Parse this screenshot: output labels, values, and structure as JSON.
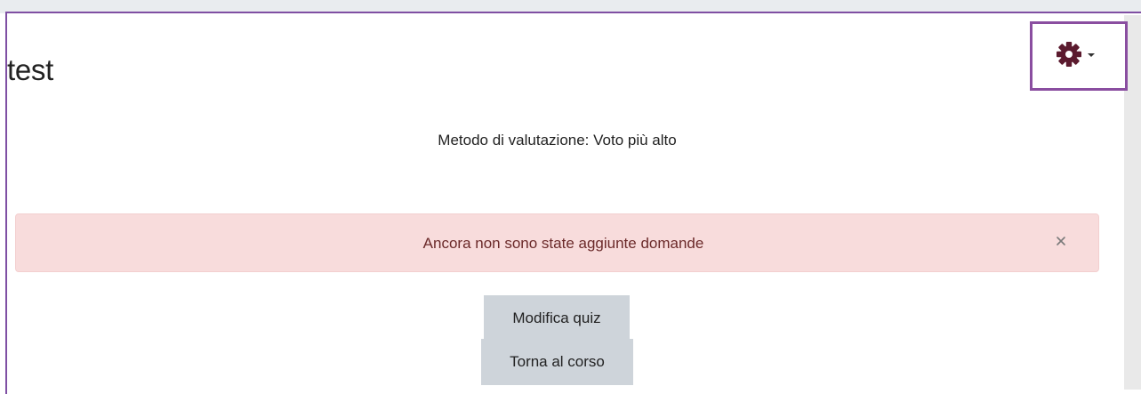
{
  "page": {
    "title": "test"
  },
  "settings_menu": {
    "icon": "gear-icon",
    "caret_icon": "caret-down-icon",
    "highlight_color": "#8a4ea0",
    "icon_color": "#5b1a2e"
  },
  "quiz_info": {
    "grading_method": "Metodo di valutazione: Voto più alto"
  },
  "alert": {
    "message": "Ancora non sono state aggiunte domande",
    "close_symbol": "×",
    "background": "#f8dcdc"
  },
  "actions": {
    "edit_quiz_label": "Modifica quiz",
    "back_to_course_label": "Torna al corso"
  }
}
